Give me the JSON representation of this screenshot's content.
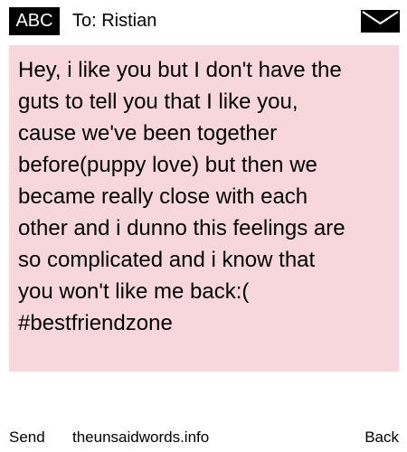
{
  "header": {
    "badge": "ABC",
    "to_label": "To: Ristian",
    "envelope_icon": "envelope-icon"
  },
  "message": {
    "text": "Hey, i like you but I don't have the\nguts to tell you that I like you,\ncause we've been together\nbefore(puppy love) but then we\nbecame really close with each\nother and i dunno this feelings are\nso complicated and i know that\nyou won't like me back:(\n#bestfriendzone",
    "background": "#f8d7dc"
  },
  "footer": {
    "send_label": "Send",
    "site": "theunsaidwords.info",
    "back_label": "Back"
  }
}
